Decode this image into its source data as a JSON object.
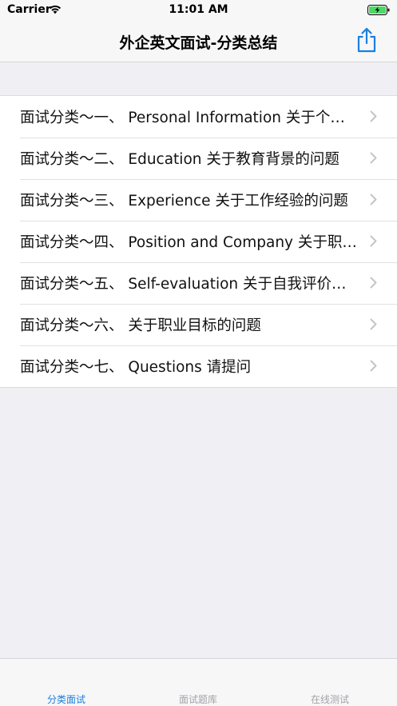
{
  "status": {
    "carrier": "Carrier",
    "time": "11:01 AM"
  },
  "nav": {
    "title": "外企英文面试-分类总结"
  },
  "colors": {
    "accent": "#1a7fe0",
    "battery": "#4cd964",
    "inactive": "#a3a3a8"
  },
  "icons": {
    "share": "share-icon",
    "chevron": "chevron-right-icon",
    "wifi": "wifi-icon",
    "battery": "battery-charging-icon"
  },
  "list": {
    "items": [
      {
        "label": "面试分类～一、 Personal Information 关于个人信息的问题"
      },
      {
        "label": "面试分类～二、 Education 关于教育背景的问题"
      },
      {
        "label": "面试分类～三、 Experience 关于工作经验的问题"
      },
      {
        "label": "面试分类～四、 Position and Company 关于职位和公司的问题"
      },
      {
        "label": "面试分类～五、 Self-evaluation 关于自我评价的问题"
      },
      {
        "label": "面试分类～六、 关于职业目标的问题"
      },
      {
        "label": "面试分类～七、 Questions 请提问"
      }
    ]
  },
  "tabs": [
    {
      "label": "分类面试",
      "active": true
    },
    {
      "label": "面试题库",
      "active": false
    },
    {
      "label": "在线测试",
      "active": false
    }
  ]
}
